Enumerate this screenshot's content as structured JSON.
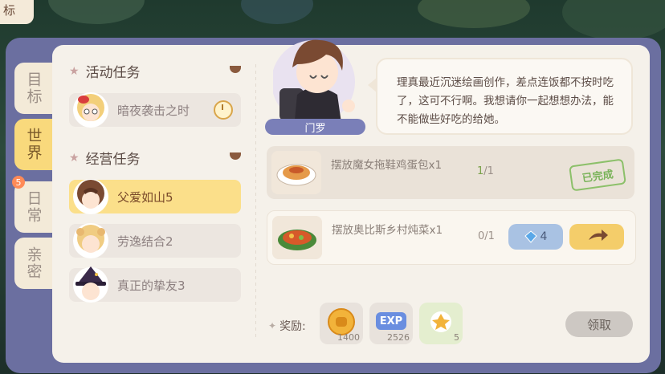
{
  "corner_tab": {
    "label": "标"
  },
  "side_tabs": [
    {
      "label": "目标",
      "active": false
    },
    {
      "label": "世界",
      "active": true
    },
    {
      "label": "日常",
      "active": false,
      "badge": "5"
    },
    {
      "label": "亲密",
      "active": false
    }
  ],
  "sections": {
    "activity": {
      "title": "活动任务",
      "items": [
        {
          "label": "暗夜袭击之时",
          "icon": "clock-icon"
        }
      ]
    },
    "business": {
      "title": "经营任务",
      "items": [
        {
          "label": "父爱如山5",
          "active": true
        },
        {
          "label": "劳逸结合2",
          "active": false
        },
        {
          "label": "真正的挚友3",
          "active": false
        }
      ]
    }
  },
  "npc": {
    "name": "门罗",
    "dialogue": "理真最近沉迷绘画创作，差点连饭都不按时吃了，这可不行啊。我想请你一起想想办法，能不能做些好吃的给她。"
  },
  "goals": [
    {
      "text": "摆放魔女拖鞋鸡蛋包x1",
      "progress_current": "1",
      "progress_total": "/1",
      "status": "已完成"
    },
    {
      "text": "摆放奥比斯乡村炖菜x1",
      "progress_current": "0",
      "progress_total": "/1",
      "gem_cost": "4"
    }
  ],
  "rewards": {
    "label": "奖励:",
    "items": [
      {
        "name": "coin",
        "count": "1400"
      },
      {
        "name": "exp",
        "icon_text": "EXP",
        "count": "2526"
      },
      {
        "name": "cookie",
        "count": "5"
      }
    ]
  },
  "claim_button": "领取",
  "colors": {
    "accent": "#f9d97c",
    "frame": "#6b6fa0",
    "panel": "#f5f1ea",
    "done": "#7ab35a"
  }
}
